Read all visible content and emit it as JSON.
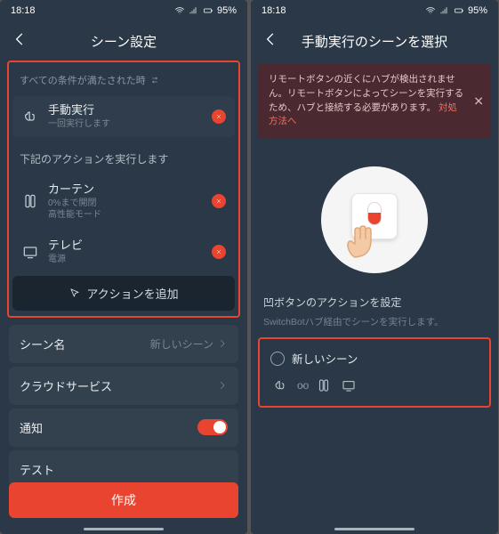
{
  "status": {
    "time": "18:18",
    "battery": "95%"
  },
  "screen1": {
    "title": "シーン設定",
    "condition_label": "すべての条件が満たされた時",
    "trigger": {
      "title": "手動実行",
      "sub": "一回実行します"
    },
    "actions_label": "下記のアクションを実行します",
    "actions": [
      {
        "title": "カーテン",
        "sub1": "0%まで開閉",
        "sub2": "高性能モード"
      },
      {
        "title": "テレビ",
        "sub1": "電源"
      }
    ],
    "add_action": "アクションを追加",
    "rows": {
      "scene_name_label": "シーン名",
      "scene_name_value": "新しいシーン",
      "cloud_label": "クラウドサービス",
      "notify_label": "通知",
      "test_label": "テスト"
    },
    "create": "作成"
  },
  "screen2": {
    "title": "手動実行のシーンを選択",
    "alert_text": "リモートボタンの近くにハブが検出されません。リモートボタンによってシーンを実行するため、ハブと接続する必要があります。",
    "alert_link": "対処方法へ",
    "section_title": "凹ボタンのアクションを設定",
    "section_sub": "SwitchBotハブ経由でシーンを実行します。",
    "scene_option": "新しいシーン"
  }
}
